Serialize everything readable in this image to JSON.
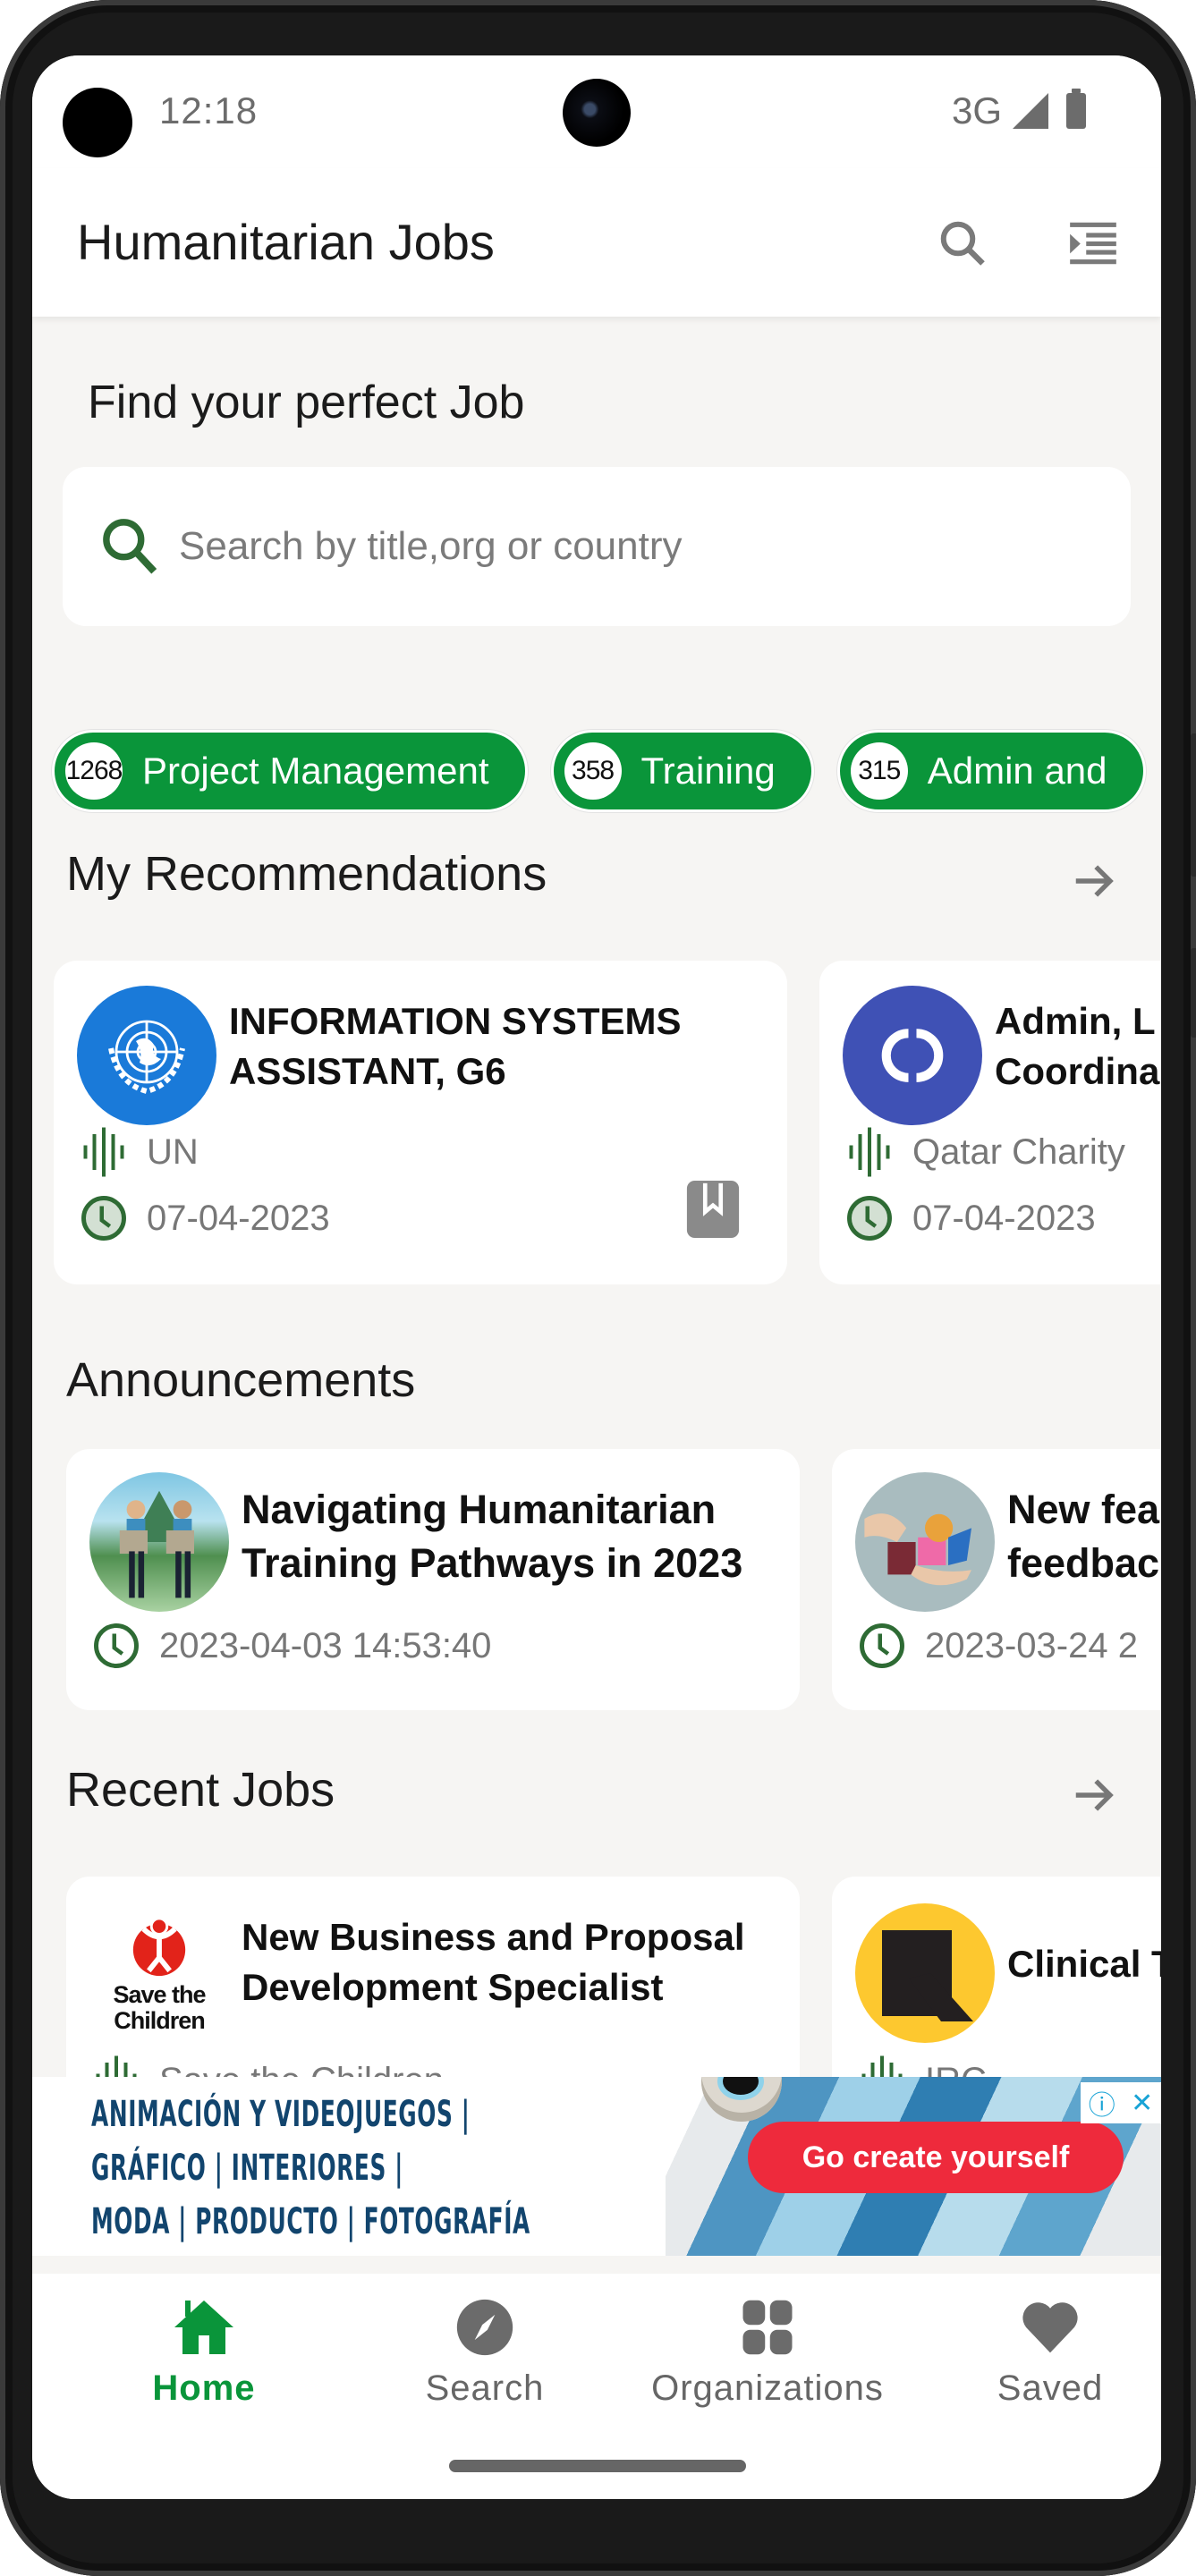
{
  "status_bar": {
    "time": "12:18",
    "network": "3G"
  },
  "app_bar": {
    "title": "Humanitarian Jobs",
    "search_icon": "search-icon",
    "menu_icon": "format-indent-icon"
  },
  "hero": {
    "title": "Find your perfect Job",
    "search": {
      "placeholder": "Search by title,org or country",
      "value": ""
    }
  },
  "categories": [
    {
      "count": "1268",
      "label": "Project Management"
    },
    {
      "count": "358",
      "label": "Training"
    },
    {
      "count": "315",
      "label": "Admin and"
    }
  ],
  "recommendations": {
    "title": "My Recommendations",
    "items": [
      {
        "title_line1": "INFORMATION SYSTEMS",
        "title_line2": "ASSISTANT, G6",
        "org": "UN",
        "date": "07-04-2023",
        "logo": "un-emblem",
        "logo_color": "#1a7ad9"
      },
      {
        "title_line1": "Admin, L",
        "title_line2": "Coordina",
        "org": "Qatar Charity",
        "date": "07-04-2023",
        "logo": "qatar-charity-logo",
        "logo_color": "#3f51b5"
      }
    ]
  },
  "announcements": {
    "title": "Announcements",
    "items": [
      {
        "title_line1": "Navigating Humanitarian",
        "title_line2": "Training Pathways in 2023",
        "datetime": "2023-04-03 14:53:40"
      },
      {
        "title_line1": "New fea",
        "title_line2": "feedbac",
        "datetime": "2023-03-24 2"
      }
    ]
  },
  "recent_jobs": {
    "title": "Recent Jobs",
    "items": [
      {
        "title_line1": "New Business and Proposal",
        "title_line2": "Development Specialist",
        "org": "Save the Children",
        "logo_text_1": "Save the",
        "logo_text_2": "Children",
        "date": ""
      },
      {
        "title_line1": "Clinical T",
        "title_line2": "",
        "org": "IRC",
        "date": ""
      }
    ]
  },
  "ad": {
    "lines": [
      "ANIMACIÓN Y VIDEOJUEGOS |",
      "GRÁFICO | INTERIORES |",
      "MODA | PRODUCTO | FOTOGRAFÍA"
    ],
    "cta": "Go create yourself",
    "badge_info": "ⓘ",
    "badge_close": "✕"
  },
  "bottom_nav": [
    {
      "label": "Home",
      "icon": "home-icon",
      "active": true
    },
    {
      "label": "Search",
      "icon": "compass-icon",
      "active": false
    },
    {
      "label": "Organizations",
      "icon": "grid-icon",
      "active": false
    },
    {
      "label": "Saved",
      "icon": "heart-icon",
      "active": false
    }
  ],
  "colors": {
    "accent": "#0a953a",
    "icon_green": "#2e6b34",
    "icon_grey": "#7a7a7a",
    "background": "#f6f5f3"
  }
}
